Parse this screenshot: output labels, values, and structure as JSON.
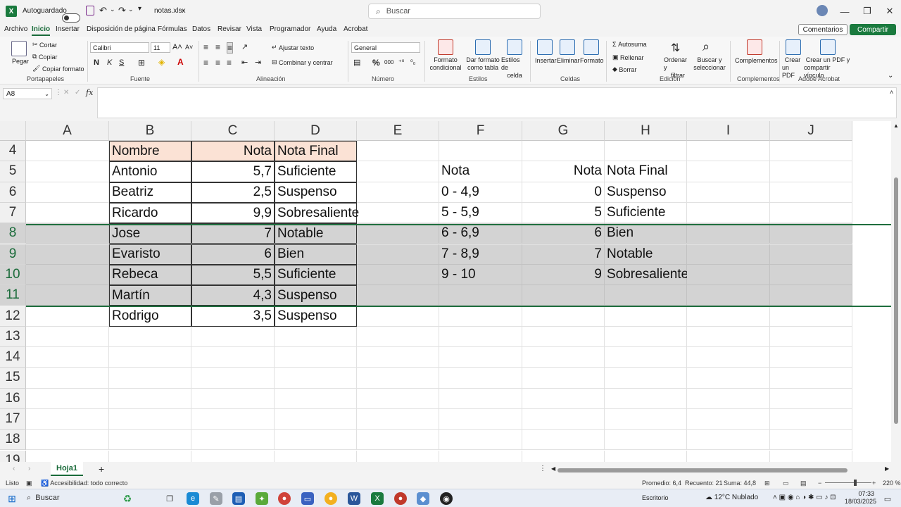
{
  "titlebar": {
    "autosave_label": "Autoguardado",
    "filename": "notas.xlsx",
    "search_placeholder": "Buscar"
  },
  "tabs": [
    "Archivo",
    "Inicio",
    "Insertar",
    "Disposición de página",
    "Fórmulas",
    "Datos",
    "Revisar",
    "Vista",
    "Programador",
    "Ayuda",
    "Acrobat"
  ],
  "active_tab": "Inicio",
  "comments_label": "Comentarios",
  "share_label": "Compartir",
  "ribbon": {
    "paste": "Pegar",
    "cut": "Cortar",
    "copy": "Copiar",
    "format_painter": "Copiar formato",
    "clipboard_group": "Portapapeles",
    "font_name": "Calibri",
    "font_size": "11",
    "bold": "N",
    "italic": "K",
    "underline": "S",
    "font_group": "Fuente",
    "wrap_text": "Ajustar texto",
    "merge_center": "Combinar y centrar",
    "alignment_group": "Alineación",
    "number_format": "General",
    "percent": "%",
    "thousands": "000",
    "number_group": "Número",
    "conditional_format": [
      "Formato",
      "condicional"
    ],
    "format_as_table": [
      "Dar formato",
      "como tabla"
    ],
    "cell_styles": [
      "Estilos de",
      "celda"
    ],
    "styles_group": "Estilos",
    "insert": "Insertar",
    "delete": "Eliminar",
    "format": "Formato",
    "cells_group": "Celdas",
    "autosum": "Autosuma",
    "fill": "Rellenar",
    "clear": "Borrar",
    "sort_filter": [
      "Ordenar y",
      "filtrar"
    ],
    "find_select": [
      "Buscar y",
      "seleccionar"
    ],
    "editing_group": "Edición",
    "addins": "Complementos",
    "addins_group": "Complementos",
    "create_pdf": [
      "Crear",
      "un PDF"
    ],
    "create_pdf_share": [
      "Crear un PDF y",
      "compartir vínculo"
    ],
    "acrobat_group": "Adobe Acrobat"
  },
  "formula_bar": {
    "name_box": "A8",
    "fx": "fx",
    "content": ""
  },
  "columns": [
    "A",
    "B",
    "C",
    "D",
    "E",
    "F",
    "G",
    "H",
    "I",
    "J"
  ],
  "rows": [
    "4",
    "5",
    "6",
    "7",
    "8",
    "9",
    "10",
    "11",
    "12",
    "13",
    "14",
    "15",
    "16",
    "17",
    "18",
    "19"
  ],
  "cells": {
    "B4": "Nombre",
    "C4": "Nota",
    "D4": "Nota Final",
    "B5": "Antonio",
    "C5": "5,7",
    "D5": "Suficiente",
    "B6": "Beatriz",
    "C6": "2,5",
    "D6": "Suspenso",
    "B7": "Ricardo",
    "C7": "9,9",
    "D7": "Sobresaliente",
    "B8": "Jose",
    "C8": "7",
    "D8": "Notable",
    "B9": "Evaristo",
    "C9": "6",
    "D9": "Bien",
    "B10": "Rebeca",
    "C10": "5,5",
    "D10": "Suficiente",
    "B11": "Martín",
    "C11": "4,3",
    "D11": "Suspenso",
    "B12": "Rodrigo",
    "C12": "3,5",
    "D12": "Suspenso",
    "F5": "Nota",
    "G5": "Nota",
    "H5": "Nota Final",
    "F6": "0 - 4,9",
    "G6": "0",
    "H6": "Suspenso",
    "F7": "5 - 5,9",
    "G7": "5",
    "H7": "Suficiente",
    "F8": "6 - 6,9",
    "G8": "6",
    "H8": "Bien",
    "F9": "7 - 8,9",
    "G9": "7",
    "H9": "Notable",
    "F10": "9 - 10",
    "G10": "9",
    "H10": "Sobresaliente"
  },
  "sheet_tab": "Hoja1",
  "status": {
    "ready": "Listo",
    "accessibility": "Accesibilidad: todo correcto",
    "average": "Promedio: 6,4",
    "count": "Recuento: 21",
    "sum": "Suma: 44,8",
    "zoom": "220 %"
  },
  "taskbar": {
    "search": "Buscar",
    "desktop": "Escritorio",
    "weather": "12°C  Nublado",
    "time": "07:33",
    "date": "18/03/2025"
  },
  "colors": {
    "excel_green": "#1a6b3a",
    "header_fill": "#fbe2d5",
    "selection_fill": "#d3d3d3"
  }
}
